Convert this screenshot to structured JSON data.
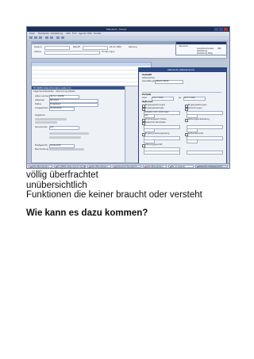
{
  "screenshot": {
    "window_title": "Mandant - Haupt",
    "menu": [
      "Datei",
      "Bearbeiten",
      "Darstellung",
      "Akte",
      "Frist",
      "Agenda",
      "Hilfe",
      "Fenster"
    ],
    "header": {
      "labels": [
        "Dateinr.",
        "Aktenz.",
        "Betreff",
        "Forderungen",
        "Zahlung"
      ],
      "date_value": "05.07.2006"
    },
    "left_panel": {
      "title": "FK 36956 Akteninformation (Akte 2.0)",
      "tabs": [
        "Allgemein",
        "Unterakten",
        "Abrechnung",
        "Details"
      ],
      "fields": [
        {
          "label": "Aktennummer",
          "value": "36-51 / 09056"
        },
        {
          "label": "Aktenbez.",
          "value": "Mandant"
        },
        {
          "label": "Status",
          "value": "Eingelesen"
        },
        {
          "label": "Anlagedatum",
          "value": "02.06.2006"
        },
        {
          "label": "Sachbearb.",
          "value": "Wulf"
        },
        {
          "label": "Kennzeichen",
          "value": "0/4"
        },
        {
          "label": "Briefgewicht",
          "value": "0434/2006"
        },
        {
          "label": "Beschreibung",
          "value": ""
        }
      ],
      "section_label": "Gegebene"
    },
    "dialog": {
      "title": "Akteneinfo (Detailansicht)",
      "section_general": "Auswahl",
      "general_fields": [
        {
          "label": "Aktenzeichen",
          "value": ""
        },
        {
          "label": "Geschäfts-Jahr",
          "value": "098/23 0809h"
        }
      ],
      "section_period": "Periode",
      "period": {
        "from_label": "Zeitr.",
        "from_value": "03.07.2006",
        "to_label": "bis",
        "to_value": "05.07.2006"
      },
      "section_options": "Optionen",
      "options": [
        "Eingangsrechnungen",
        "Eingangsleistungen",
        "Kontoausgleich Posten",
        "Kostenfrei-Handakten",
        "Eingang Leistungsauszug",
        "Zahlungsgeschäft"
      ],
      "options_right": [
        "Eingangszahlungen",
        "Abrechnungen",
        "Zahlungseinbehaltung",
        "Kostenübersicht"
      ],
      "select_value": "Ausgabe nach Leistungen",
      "small_value": "100"
    },
    "right_panel": {
      "title": "Übersicht",
      "lines": [
        "Auszahlenhinweis",
        "Zahlbetrag",
        "Zahlbetrag Fällig"
      ],
      "values": [
        "368",
        "",
        ""
      ]
    },
    "taskbar": [
      {
        "label": "Akte (Mandanten)"
      },
      {
        "label": "FK 36956 (Akte 2.0) 07.11.06"
      },
      {
        "label": "Akte (Mandanten)"
      },
      {
        "label": "Aktenbrief (Kanzleimit...)"
      },
      {
        "label": "Akte (Mandanten)"
      },
      {
        "label": "Tel. an Gegner"
      },
      {
        "label": "Akteninfo (Detailansicht)"
      }
    ]
  },
  "caption_lines": [
    "völlig überfrachtet",
    "unübersichtlich",
    "Funktionen die keiner braucht oder versteht"
  ],
  "question": "Wie kann es dazu kommen?"
}
